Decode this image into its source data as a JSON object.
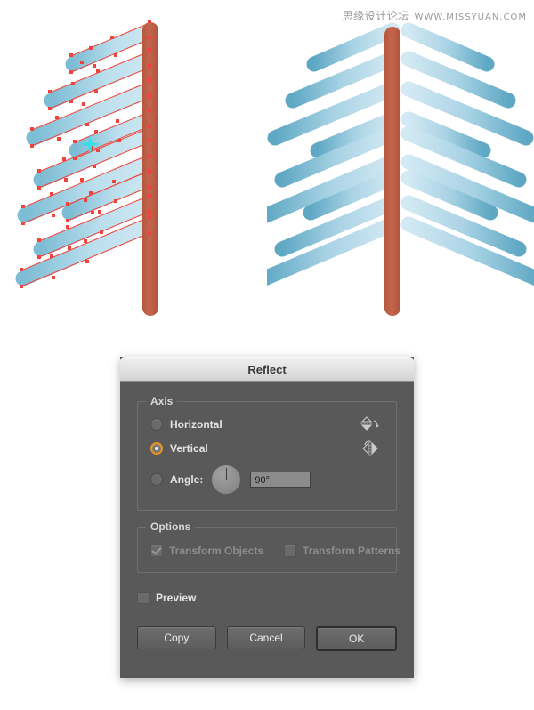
{
  "watermark": {
    "cn_text": "思缘设计论坛",
    "url_text": "WWW.MISSYUAN.COM"
  },
  "illustration": {
    "left_label": "selected-branches-with-anchor-points",
    "right_label": "mirrored-tree-result",
    "colors": {
      "trunk": "#c2614a",
      "trunk_shadow": "#b15540",
      "branch_light": "#cbe4ef",
      "branch_mid": "#a9d3e5",
      "branch_dark": "#5fa8c4",
      "selection_red": "#f0433a",
      "anchor_cyan": "#36e0e8",
      "selected_fill": "#bfe0ec"
    }
  },
  "dialog": {
    "title": "Reflect",
    "axis": {
      "legend": "Axis",
      "options": [
        {
          "label": "Horizontal",
          "selected": false,
          "icon": "reflect-horizontal-icon"
        },
        {
          "label": "Vertical",
          "selected": true,
          "icon": "reflect-vertical-icon"
        }
      ],
      "angle": {
        "label": "Angle:",
        "selected": false,
        "value": "90°",
        "dial_degrees": 90
      }
    },
    "options": {
      "legend": "Options",
      "checkboxes": [
        {
          "label": "Transform Objects",
          "checked": true,
          "disabled": true
        },
        {
          "label": "Transform Patterns",
          "checked": false,
          "disabled": true
        }
      ]
    },
    "preview": {
      "label": "Preview",
      "checked": false
    },
    "buttons": [
      {
        "label": "Copy",
        "default": false
      },
      {
        "label": "Cancel",
        "default": false
      },
      {
        "label": "OK",
        "default": true
      }
    ]
  }
}
